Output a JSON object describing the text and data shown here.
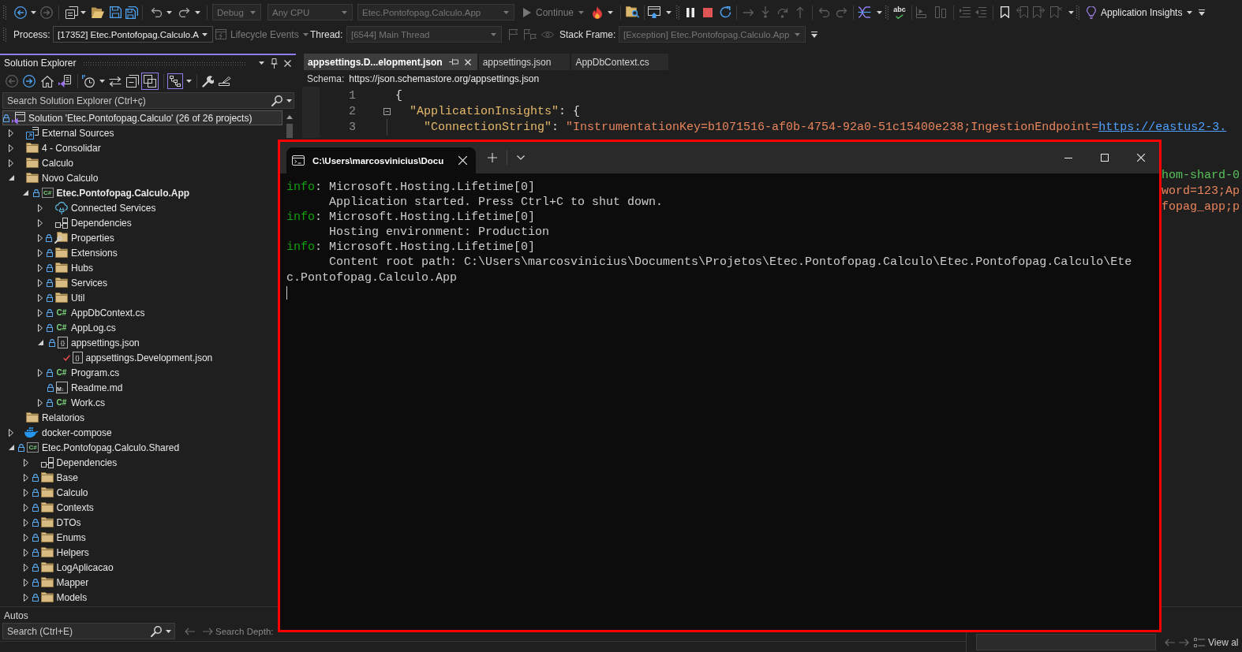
{
  "toolbar": {
    "configuration": {
      "value": "Debug",
      "disabled": true
    },
    "platform": {
      "value": "Any CPU",
      "disabled": true
    },
    "startup_item": {
      "value": "Etec.Pontofopag.Calculo.App",
      "disabled": true
    },
    "continue_button": {
      "label": "Continue",
      "disabled": true
    },
    "spell_check": {
      "icon_text": "abc"
    },
    "insights_button": {
      "label": "Application Insights"
    }
  },
  "debug_location": {
    "process_label": "Process:",
    "process": {
      "value": "[17352] Etec.Pontofopag.Calculo.A",
      "disabled": false
    },
    "lifecycle_events": {
      "label": "Lifecycle Events",
      "disabled": true
    },
    "thread_label": "Thread:",
    "thread": {
      "value": "[6544] Main Thread",
      "disabled": true
    },
    "stack_frame_label": "Stack Frame:",
    "stack_frame": {
      "value": "[Exception] Etec.Pontofopag.Calculo.App",
      "disabled": true
    }
  },
  "solution_explorer": {
    "title": "Solution Explorer",
    "toolbar": {
      "pages_toggle": {
        "on": true
      },
      "hierarchy_toggle": {
        "on": true
      }
    },
    "search": {
      "placeholder": "Search Solution Explorer (Ctrl+ç)"
    },
    "tree": [
      {
        "kind": "solution",
        "label": "Solution 'Etec.Pontofopag.Calculo' (26 of 26 projects)",
        "locked": true,
        "checked_out": false,
        "selected": true,
        "children": [
          {
            "kind": "external",
            "label": "External Sources",
            "locked": false,
            "checked_out": false,
            "expanded": false,
            "selected": false
          },
          {
            "kind": "folder",
            "label": "4 - Consolidar",
            "locked": false,
            "checked_out": false,
            "expanded": false,
            "selected": false
          },
          {
            "kind": "folder",
            "label": "Calculo",
            "locked": false,
            "checked_out": false,
            "expanded": false,
            "selected": false
          },
          {
            "kind": "folder",
            "label": "Novo Calculo",
            "locked": false,
            "checked_out": false,
            "expanded": true,
            "selected": false,
            "children": [
              {
                "kind": "project",
                "icon_text": "C#",
                "label": "Etec.Pontofopag.Calculo.App",
                "locked": true,
                "checked_out": false,
                "startup": true,
                "expanded": true,
                "selected": false,
                "children": [
                  {
                    "kind": "connected",
                    "label": "Connected Services",
                    "locked": false,
                    "checked_out": false,
                    "expanded": false,
                    "selected": false
                  },
                  {
                    "kind": "dependencies",
                    "label": "Dependencies",
                    "locked": false,
                    "checked_out": false,
                    "expanded": false,
                    "selected": false
                  },
                  {
                    "kind": "properties",
                    "label": "Properties",
                    "locked": true,
                    "checked_out": false,
                    "expanded": false,
                    "selected": false
                  },
                  {
                    "kind": "folder",
                    "label": "Extensions",
                    "locked": true,
                    "checked_out": false,
                    "expanded": false,
                    "selected": false
                  },
                  {
                    "kind": "folder",
                    "label": "Hubs",
                    "locked": true,
                    "checked_out": false,
                    "expanded": false,
                    "selected": false
                  },
                  {
                    "kind": "folder",
                    "label": "Services",
                    "locked": true,
                    "checked_out": false,
                    "expanded": false,
                    "selected": false
                  },
                  {
                    "kind": "folder",
                    "label": "Util",
                    "locked": true,
                    "checked_out": false,
                    "expanded": false,
                    "selected": false
                  },
                  {
                    "kind": "code",
                    "icon_text": "C#",
                    "label": "AppDbContext.cs",
                    "locked": true,
                    "checked_out": false,
                    "expanded": false,
                    "selected": false
                  },
                  {
                    "kind": "code",
                    "icon_text": "C#",
                    "label": "AppLog.cs",
                    "locked": true,
                    "checked_out": false,
                    "expanded": false,
                    "selected": false
                  },
                  {
                    "kind": "json",
                    "icon_text": "{}",
                    "label": "appsettings.json",
                    "locked": true,
                    "checked_out": false,
                    "expanded": true,
                    "selected": false,
                    "children": [
                      {
                        "kind": "json",
                        "icon_text": "{}",
                        "label": "appsettings.Development.json",
                        "locked": false,
                        "checked_out": true,
                        "selected": false
                      }
                    ]
                  },
                  {
                    "kind": "code",
                    "icon_text": "C#",
                    "label": "Program.cs",
                    "locked": true,
                    "checked_out": false,
                    "expanded": false,
                    "selected": false
                  },
                  {
                    "kind": "markdown",
                    "icon_text": "M↓",
                    "label": "Readme.md",
                    "locked": true,
                    "checked_out": false,
                    "selected": false
                  },
                  {
                    "kind": "code",
                    "icon_text": "C#",
                    "label": "Work.cs",
                    "locked": true,
                    "checked_out": false,
                    "expanded": false,
                    "selected": false
                  }
                ]
              }
            ]
          },
          {
            "kind": "folder",
            "label": "Relatorios",
            "locked": false,
            "checked_out": false,
            "selected": false
          },
          {
            "kind": "docker",
            "label": "docker-compose",
            "locked": false,
            "checked_out": false,
            "expanded": false,
            "selected": false
          },
          {
            "kind": "project",
            "icon_text": "C#",
            "label": "Etec.Pontofopag.Calculo.Shared",
            "locked": true,
            "checked_out": false,
            "startup": false,
            "expanded": true,
            "selected": false,
            "children": [
              {
                "kind": "dependencies",
                "label": "Dependencies",
                "locked": false,
                "checked_out": false,
                "expanded": false,
                "selected": false
              },
              {
                "kind": "folder",
                "label": "Base",
                "locked": true,
                "checked_out": false,
                "expanded": false,
                "selected": false
              },
              {
                "kind": "folder",
                "label": "Calculo",
                "locked": true,
                "checked_out": false,
                "expanded": false,
                "selected": false
              },
              {
                "kind": "folder",
                "label": "Contexts",
                "locked": true,
                "checked_out": false,
                "expanded": false,
                "selected": false
              },
              {
                "kind": "folder",
                "label": "DTOs",
                "locked": true,
                "checked_out": false,
                "expanded": false,
                "selected": false
              },
              {
                "kind": "folder",
                "label": "Enums",
                "locked": true,
                "checked_out": false,
                "expanded": false,
                "selected": false
              },
              {
                "kind": "folder",
                "label": "Helpers",
                "locked": true,
                "checked_out": false,
                "expanded": false,
                "selected": false
              },
              {
                "kind": "folder",
                "label": "LogAplicacao",
                "locked": true,
                "checked_out": false,
                "expanded": false,
                "selected": false
              },
              {
                "kind": "folder",
                "label": "Mapper",
                "locked": true,
                "checked_out": false,
                "expanded": false,
                "selected": false
              },
              {
                "kind": "folder",
                "label": "Models",
                "locked": true,
                "checked_out": false,
                "expanded": false,
                "selected": false
              }
            ]
          }
        ]
      }
    ]
  },
  "editor": {
    "tabs": [
      {
        "label": "appsettings.D...elopment.json",
        "selected": true
      },
      {
        "label": "appsettings.json",
        "selected": false
      },
      {
        "label": "AppDbContext.cs",
        "selected": false
      }
    ],
    "schema_label": "Schema:",
    "schema_url": "https://json.schemastore.org/appsettings.json",
    "lines": [
      {
        "number": "1",
        "tokens": [
          {
            "kind": "punct",
            "text": "{"
          }
        ],
        "children": [
          {
            "number": "2",
            "expanded": true,
            "tokens": [
              {
                "kind": "key",
                "text": "\"ApplicationInsights\""
              },
              {
                "kind": "punct",
                "text": ": {"
              }
            ],
            "children": [
              {
                "number": "3",
                "tokens": [
                  {
                    "kind": "key",
                    "text": "\"ConnectionString\""
                  },
                  {
                    "kind": "punct",
                    "text": ": "
                  },
                  {
                    "kind": "string",
                    "text": "\"InstrumentationKey=b1071516-af0b-4754-92a0-51c15400e238;IngestionEndpoint="
                  },
                  {
                    "kind": "link",
                    "text": "https://eastus2-3."
                  }
                ]
              }
            ]
          }
        ]
      }
    ],
    "covered_line_tails": [
      {
        "tokens": [
          {
            "kind": "identifier",
            "text": "hom-shard-0"
          }
        ]
      },
      {
        "tokens": [
          {
            "kind": "string",
            "text": "word=123;Ap"
          }
        ]
      },
      {
        "tokens": [
          {
            "kind": "string",
            "text": "fopag_app;p"
          }
        ]
      }
    ]
  },
  "terminal": {
    "tab_title": "C:\\Users\\marcosvinicius\\Docu",
    "entries": [
      {
        "severity": "info",
        "source": ": Microsoft.Hosting.Lifetime[0]",
        "message": "Application started. Press Ctrl+C to shut down."
      },
      {
        "severity": "info",
        "source": ": Microsoft.Hosting.Lifetime[0]",
        "message": "Hosting environment: Production"
      },
      {
        "severity": "info",
        "source": ": Microsoft.Hosting.Lifetime[0]",
        "message": "Content root path: C:\\Users\\marcosvinicius\\Documents\\Projetos\\Etec.Pontofopag.Calculo\\Etec.Pontofopag.Calculo\\Etec.Pontofopag.Calculo.App"
      }
    ]
  },
  "autos": {
    "title": "Autos",
    "search": {
      "placeholder": "Search (Ctrl+E)"
    },
    "search_depth_label": "Search Depth:"
  },
  "side_panel": {
    "view_button": {
      "label": "View al"
    }
  }
}
